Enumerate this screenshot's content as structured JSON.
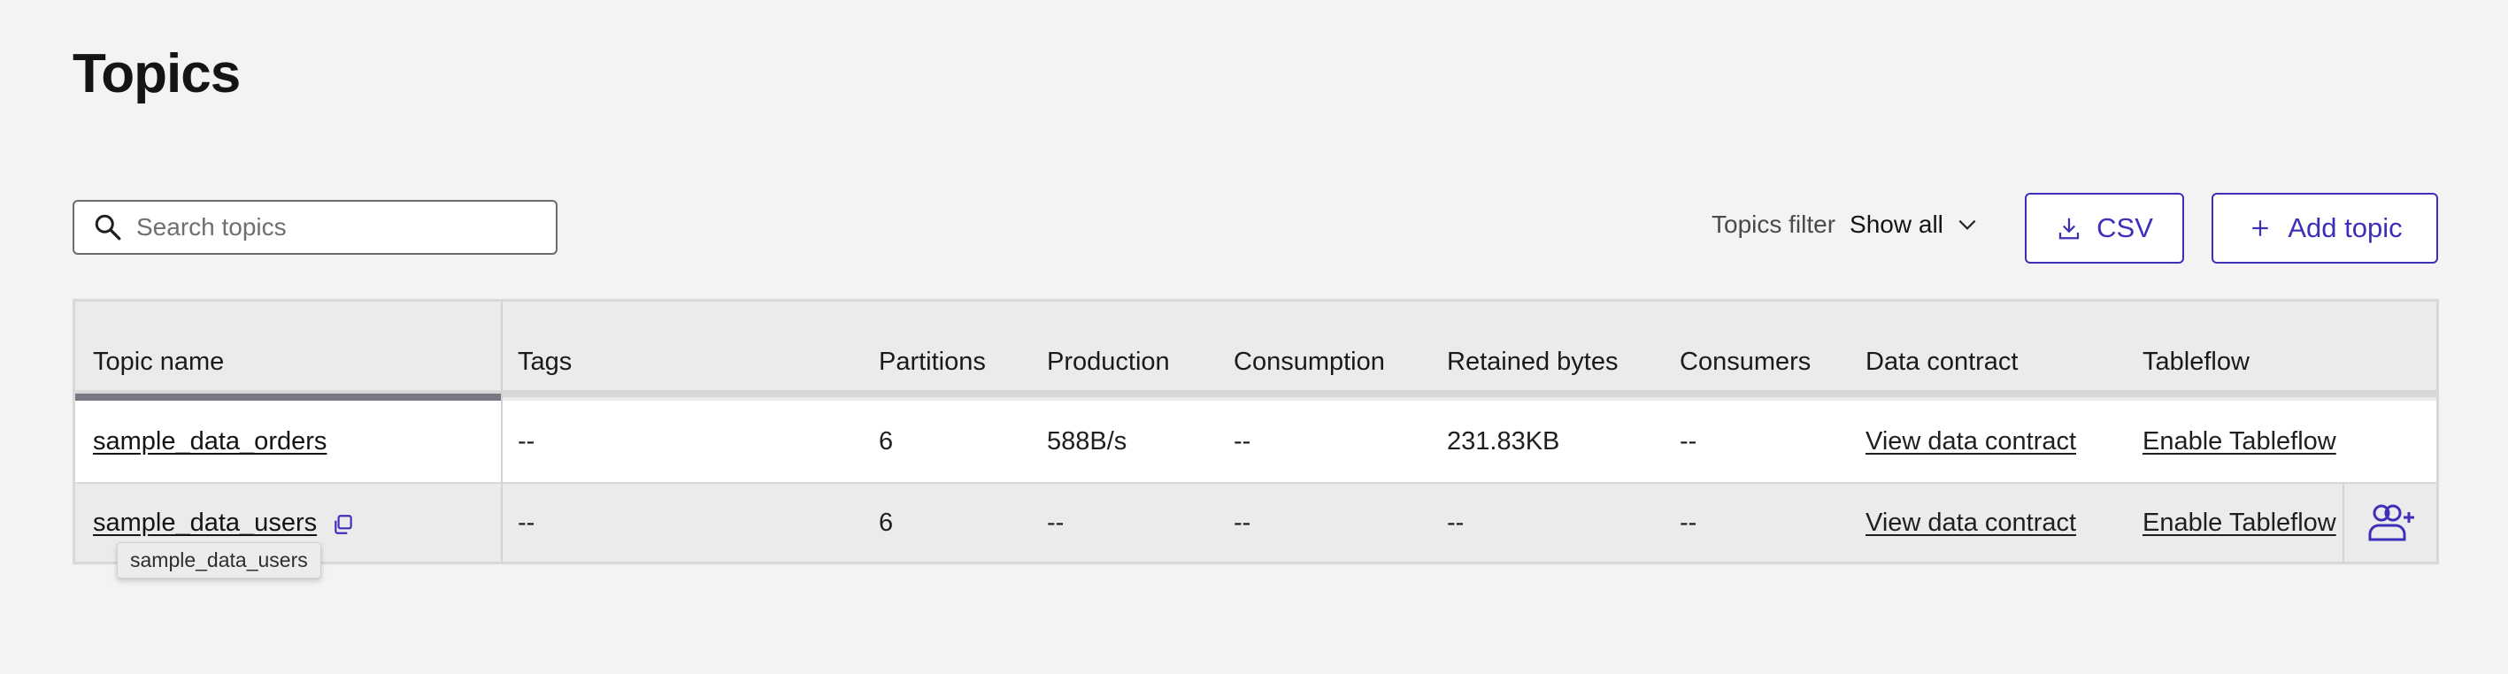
{
  "page": {
    "title": "Topics"
  },
  "search": {
    "placeholder": "Search topics",
    "value": ""
  },
  "filter": {
    "label": "Topics filter",
    "value": "Show all"
  },
  "buttons": {
    "csv": "CSV",
    "add_topic": "Add topic"
  },
  "colors": {
    "accent": "#3d2fb8",
    "background": "#f3f3f3",
    "header_bg": "#ecebeb"
  },
  "table": {
    "columns": [
      "Topic name",
      "Tags",
      "Partitions",
      "Production",
      "Consumption",
      "Retained bytes",
      "Consumers",
      "Data contract",
      "Tableflow"
    ],
    "rows": [
      {
        "topic_name": "sample_data_orders",
        "tags": "--",
        "partitions": "6",
        "production": "588B/s",
        "consumption": "--",
        "retained_bytes": "231.83KB",
        "consumers": "--",
        "data_contract": "View data contract",
        "tableflow": "Enable Tableflow"
      },
      {
        "topic_name": "sample_data_users",
        "tags": "--",
        "partitions": "6",
        "production": "--",
        "consumption": "--",
        "retained_bytes": "--",
        "consumers": "--",
        "data_contract": "View data contract",
        "tableflow": "Enable Tableflow"
      }
    ]
  },
  "tooltip": {
    "text": "sample_data_users"
  },
  "icons": {
    "search": "search-icon",
    "filter_chevron": "chevron-down-icon",
    "csv": "download-icon",
    "add": "plus-icon",
    "copy": "copy-icon",
    "row_action": "add-consumer-group-icon"
  }
}
